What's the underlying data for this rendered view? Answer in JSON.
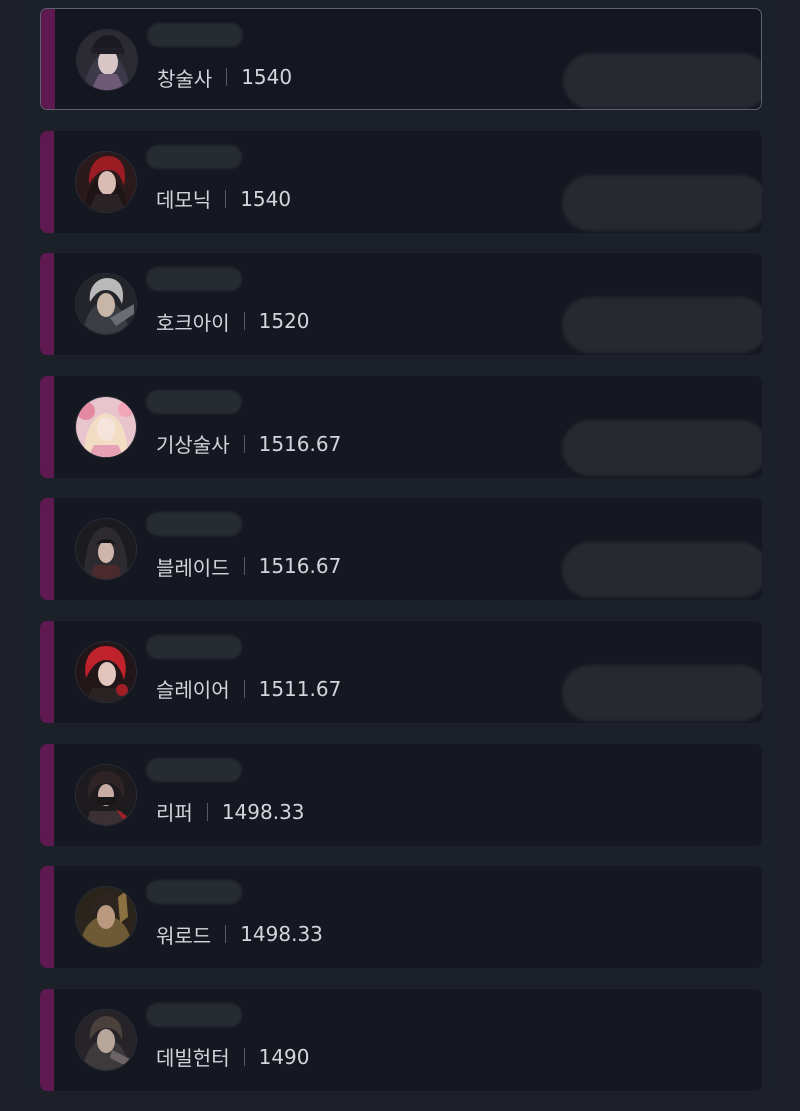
{
  "colors": {
    "accent": "#5e1a50",
    "card": "#151820",
    "background": "#1d2029",
    "text": "#d3d5dc"
  },
  "ranking": [
    {
      "class": "창술사",
      "score": "1540",
      "avatar_icon": "spear-master-portrait",
      "selected": true,
      "redacted_right": true
    },
    {
      "class": "데모닉",
      "score": "1540",
      "avatar_icon": "demonic-portrait",
      "selected": false,
      "redacted_right": true
    },
    {
      "class": "호크아이",
      "score": "1520",
      "avatar_icon": "hawkeye-portrait",
      "selected": false,
      "redacted_right": true
    },
    {
      "class": "기상술사",
      "score": "1516.67",
      "avatar_icon": "aeromancer-portrait",
      "selected": false,
      "redacted_right": true
    },
    {
      "class": "블레이드",
      "score": "1516.67",
      "avatar_icon": "blade-portrait",
      "selected": false,
      "redacted_right": true
    },
    {
      "class": "슬레이어",
      "score": "1511.67",
      "avatar_icon": "slayer-portrait",
      "selected": false,
      "redacted_right": true
    },
    {
      "class": "리퍼",
      "score": "1498.33",
      "avatar_icon": "reaper-portrait",
      "selected": false,
      "redacted_right": false
    },
    {
      "class": "워로드",
      "score": "1498.33",
      "avatar_icon": "warlord-portrait",
      "selected": false,
      "redacted_right": false
    },
    {
      "class": "데빌헌터",
      "score": "1490",
      "avatar_icon": "devil-hunter-portrait",
      "selected": false,
      "redacted_right": false
    }
  ]
}
